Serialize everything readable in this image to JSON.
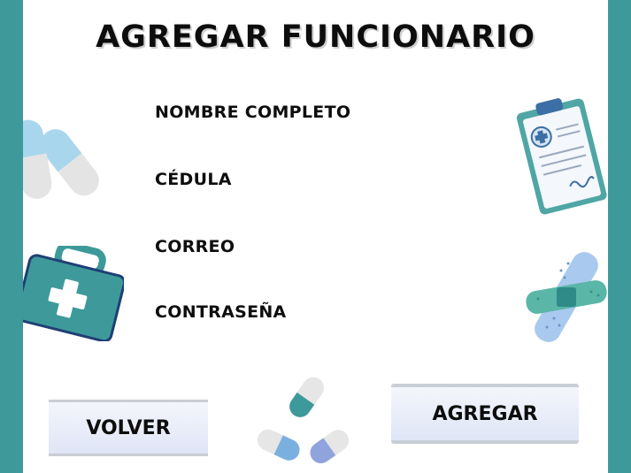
{
  "form": {
    "title": "AGREGAR FUNCIONARIO",
    "fields": [
      {
        "label": "NOMBRE COMPLETO",
        "value": ""
      },
      {
        "label": "CÉDULA",
        "value": ""
      },
      {
        "label": "CORREO",
        "value": ""
      },
      {
        "label": "CONTRASEÑA",
        "value": ""
      }
    ]
  },
  "buttons": {
    "back_label": "VOLVER",
    "add_label": "AGREGAR"
  },
  "colors": {
    "side_bar": "#3e9a9a",
    "button_fill": "#e8ecf8",
    "text": "#0d0d0d"
  },
  "icons": [
    "pills-icon",
    "clipboard-icon",
    "first-aid-kit-icon",
    "bandage-icon",
    "capsules-icon"
  ]
}
